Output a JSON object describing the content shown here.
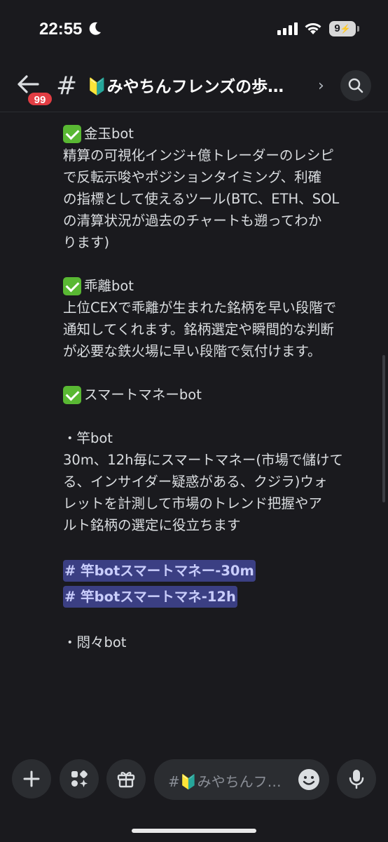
{
  "status": {
    "time": "22:55",
    "battery": "9"
  },
  "header": {
    "unread_badge": "99",
    "hash": "#",
    "channel_name": "🔰みやちんフレンズの歩…",
    "chevron": "›"
  },
  "message": {
    "section1_title": "金玉bot",
    "section1_body": [
      "精算の可視化インジ+億トレーダーのレシピ",
      "で反転示唆やポジションタイミング、利確",
      "の指標として使えるツール(BTC、ETH、SOL",
      "の清算状況が過去のチャートも遡ってわか",
      "ります)"
    ],
    "section2_title": "乖離bot",
    "section2_body": [
      "上位CEXで乖離が生まれた銘柄を早い段階で",
      "通知してくれます。銘柄選定や瞬間的な判断",
      "が必要な鉄火場に早い段階で気付けます。"
    ],
    "section3_title": "スマートマネーbot",
    "sub1_title": "・竿bot",
    "sub1_body": [
      "30m、12h毎にスマートマネー(市場で儲けて",
      "る、インサイダー疑惑がある、クジラ)ウォ",
      "レットを計測して市場のトレンド把握やア",
      "ルト銘柄の選定に役立ちます"
    ],
    "mention1": "# 竿botスマートマネー-30m",
    "mention2": "# 竿botスマートマネ-12h",
    "sub2_title": "・悶々bot"
  },
  "composer": {
    "placeholder": "#🔰みやちんフ…"
  },
  "icons": {
    "check": "check-mark-icon",
    "back": "back-arrow-icon",
    "search": "search-icon",
    "plus": "plus-icon",
    "apps": "apps-icon",
    "gift": "gift-icon",
    "emoji": "emoji-icon",
    "mic": "microphone-icon"
  },
  "colors": {
    "background": "#1a1a1e",
    "mention_bg": "#3b3f83",
    "check_green": "#59b833",
    "badge_red": "#e23d43"
  }
}
